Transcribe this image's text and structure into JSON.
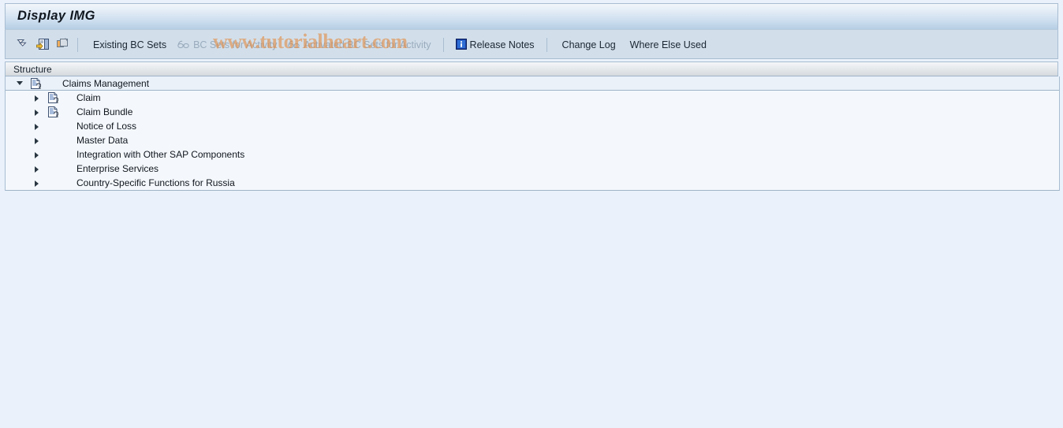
{
  "window": {
    "title": "Display IMG"
  },
  "toolbar": {
    "icon_buttons": [
      {
        "name": "collapse-all-icon",
        "label": "Collapse All"
      },
      {
        "name": "expand-subtree-icon",
        "label": "Expand Subtree"
      },
      {
        "name": "copy-structure-icon",
        "label": "Copy Structure"
      }
    ],
    "items": [
      {
        "name": "existing-bc-sets-button",
        "label": "Existing BC Sets",
        "icon": null,
        "disabled": false
      },
      {
        "name": "bc-sets-for-activity-button",
        "label": "BC Sets for Activity",
        "icon": "glasses-icon",
        "disabled": true
      },
      {
        "name": "activated-bc-sets-for-activity-button",
        "label": "Activated BC Sets for Activity",
        "icon": "glasses-icon",
        "disabled": true
      },
      {
        "name": "release-notes-button",
        "label": "Release Notes",
        "icon": "info-icon",
        "disabled": false
      },
      {
        "name": "change-log-button",
        "label": "Change Log",
        "icon": null,
        "disabled": false
      },
      {
        "name": "where-else-used-button",
        "label": "Where Else Used",
        "icon": null,
        "disabled": false
      }
    ]
  },
  "watermark": {
    "text": "www.tutorialheart.com",
    "color": "#e28c46"
  },
  "structure": {
    "header": "Structure",
    "rows": [
      {
        "label": "Claims Management",
        "depth": 0,
        "expanded": true,
        "has_icon": true
      },
      {
        "label": "Claim",
        "depth": 1,
        "expanded": false,
        "has_icon": true
      },
      {
        "label": "Claim Bundle",
        "depth": 1,
        "expanded": false,
        "has_icon": true
      },
      {
        "label": "Notice of Loss",
        "depth": 1,
        "expanded": false,
        "has_icon": false
      },
      {
        "label": "Master Data",
        "depth": 1,
        "expanded": false,
        "has_icon": false
      },
      {
        "label": "Integration with Other SAP Components",
        "depth": 1,
        "expanded": false,
        "has_icon": false
      },
      {
        "label": "Enterprise Services",
        "depth": 1,
        "expanded": false,
        "has_icon": false
      },
      {
        "label": "Country-Specific Functions for Russia",
        "depth": 1,
        "expanded": false,
        "has_icon": false
      }
    ]
  },
  "colors": {
    "page_background": "#eaf1fa",
    "toolbar_background": "#d2dfeb",
    "tree_background": "#f4f8fd",
    "border": "#a8bdd2"
  }
}
